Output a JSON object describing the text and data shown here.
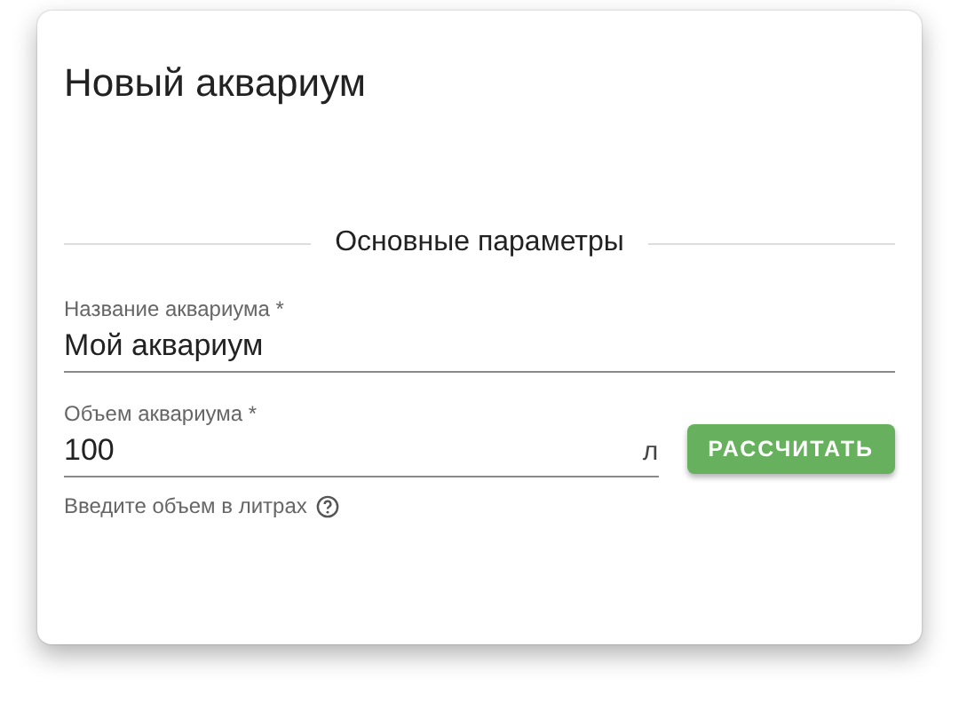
{
  "dialog": {
    "title": "Новый аквариум"
  },
  "section": {
    "title": "Основные параметры"
  },
  "fields": [
    {
      "label": "Название аквариума *",
      "value": "Мой аквариум"
    },
    {
      "label": "Объем аквариума *",
      "value": "100",
      "suffix": "л",
      "button": "РАССЧИТАТЬ",
      "hint": "Введите объем в литрах"
    }
  ]
}
